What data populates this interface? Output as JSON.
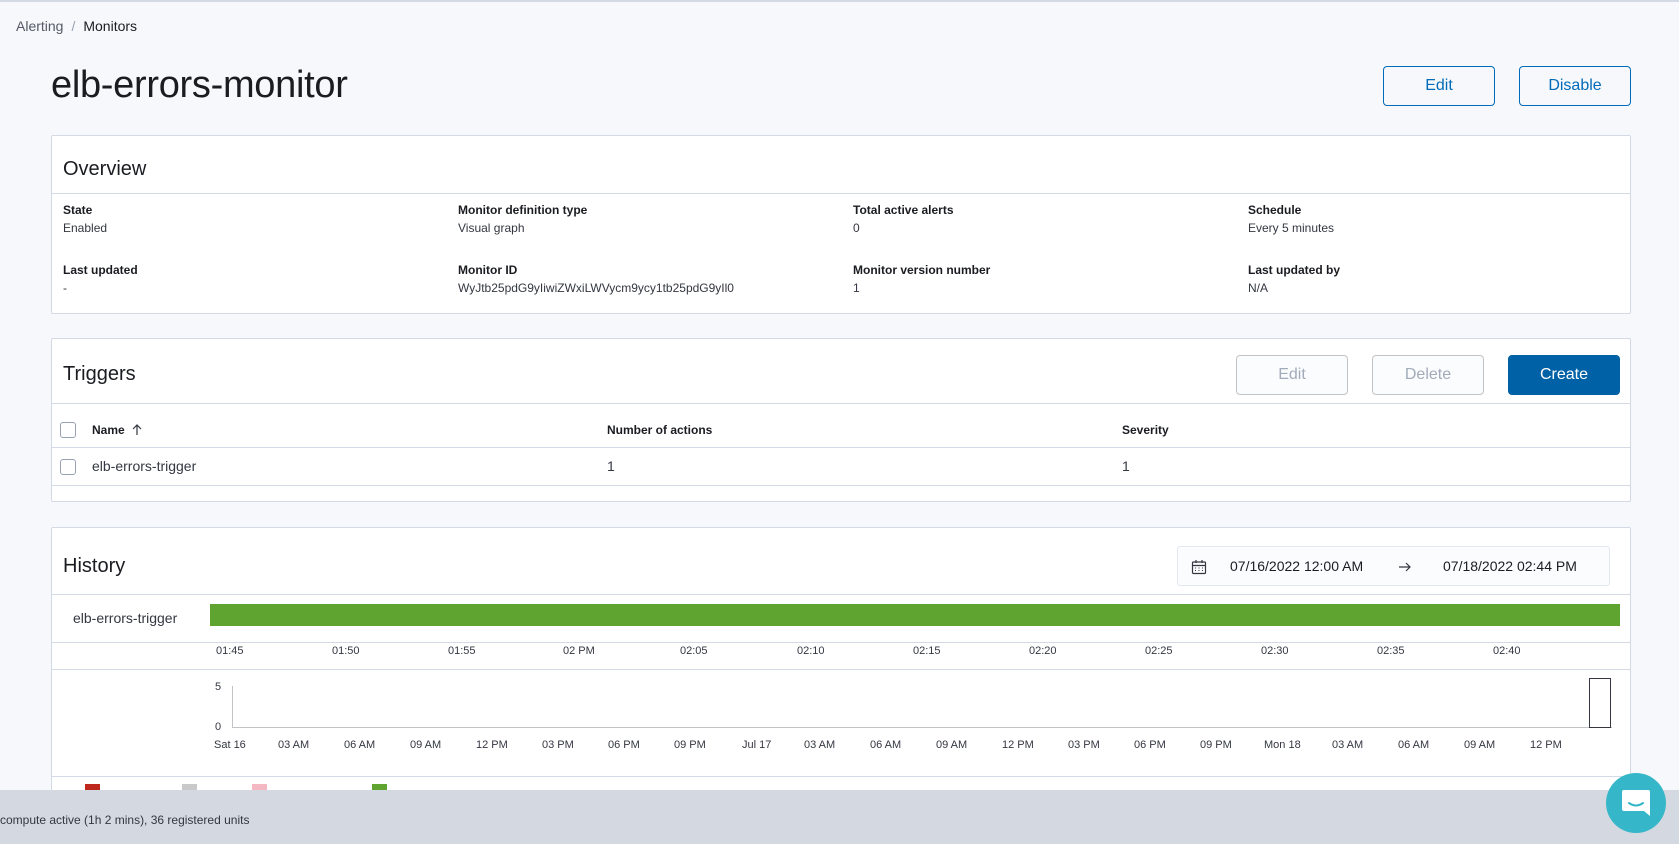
{
  "breadcrumb": {
    "parent": "Alerting",
    "separator": "/",
    "current": "Monitors"
  },
  "title": "elb-errors-monitor",
  "header_actions": {
    "edit": "Edit",
    "disable": "Disable"
  },
  "overview": {
    "title": "Overview",
    "fields": [
      {
        "label": "State",
        "value": "Enabled"
      },
      {
        "label": "Monitor definition type",
        "value": "Visual graph"
      },
      {
        "label": "Total active alerts",
        "value": "0"
      },
      {
        "label": "Schedule",
        "value": "Every 5 minutes"
      },
      {
        "label": "Last updated",
        "value": "-"
      },
      {
        "label": "Monitor ID",
        "value": "WyJtb25pdG9yIiwiZWxiLWVycm9ycy1tb25pdG9yIl0"
      },
      {
        "label": "Monitor version number",
        "value": "1"
      },
      {
        "label": "Last updated by",
        "value": "N/A"
      }
    ]
  },
  "triggers": {
    "title": "Triggers",
    "actions": {
      "edit": "Edit",
      "delete": "Delete",
      "create": "Create"
    },
    "columns": {
      "name": "Name",
      "actions": "Number of actions",
      "severity": "Severity"
    },
    "rows": [
      {
        "name": "elb-errors-trigger",
        "actions": "1",
        "severity": "1"
      }
    ]
  },
  "history": {
    "title": "History",
    "date_start": "07/16/2022 12:00 AM",
    "date_end": "07/18/2022 02:44 PM",
    "timeline": {
      "trigger_name": "elb-errors-trigger",
      "bar_color": "#5fa431",
      "ticks": [
        "01:45",
        "01:50",
        "01:55",
        "02 PM",
        "02:05",
        "02:10",
        "02:15",
        "02:20",
        "02:25",
        "02:30",
        "02:35",
        "02:40"
      ]
    },
    "overview_chart": {
      "y_ticks": [
        "5",
        "0"
      ],
      "x_ticks": [
        "Sat 16",
        "03 AM",
        "06 AM",
        "09 AM",
        "12 PM",
        "03 PM",
        "06 PM",
        "09 PM",
        "Jul 17",
        "03 AM",
        "06 AM",
        "09 AM",
        "12 PM",
        "03 PM",
        "06 PM",
        "09 PM",
        "Mon 18",
        "03 AM",
        "06 AM",
        "09 AM",
        "12 PM"
      ]
    },
    "legend_colors": [
      "#bd271e",
      "#c9c9c9",
      "#f4b8c3",
      "#5fa431"
    ]
  },
  "footer": {
    "status": "compute active (1h 2 mins), 36 registered units"
  },
  "colors": {
    "primary": "#0061a6",
    "accent": "#006bb8",
    "chat": "#35b7c9"
  }
}
